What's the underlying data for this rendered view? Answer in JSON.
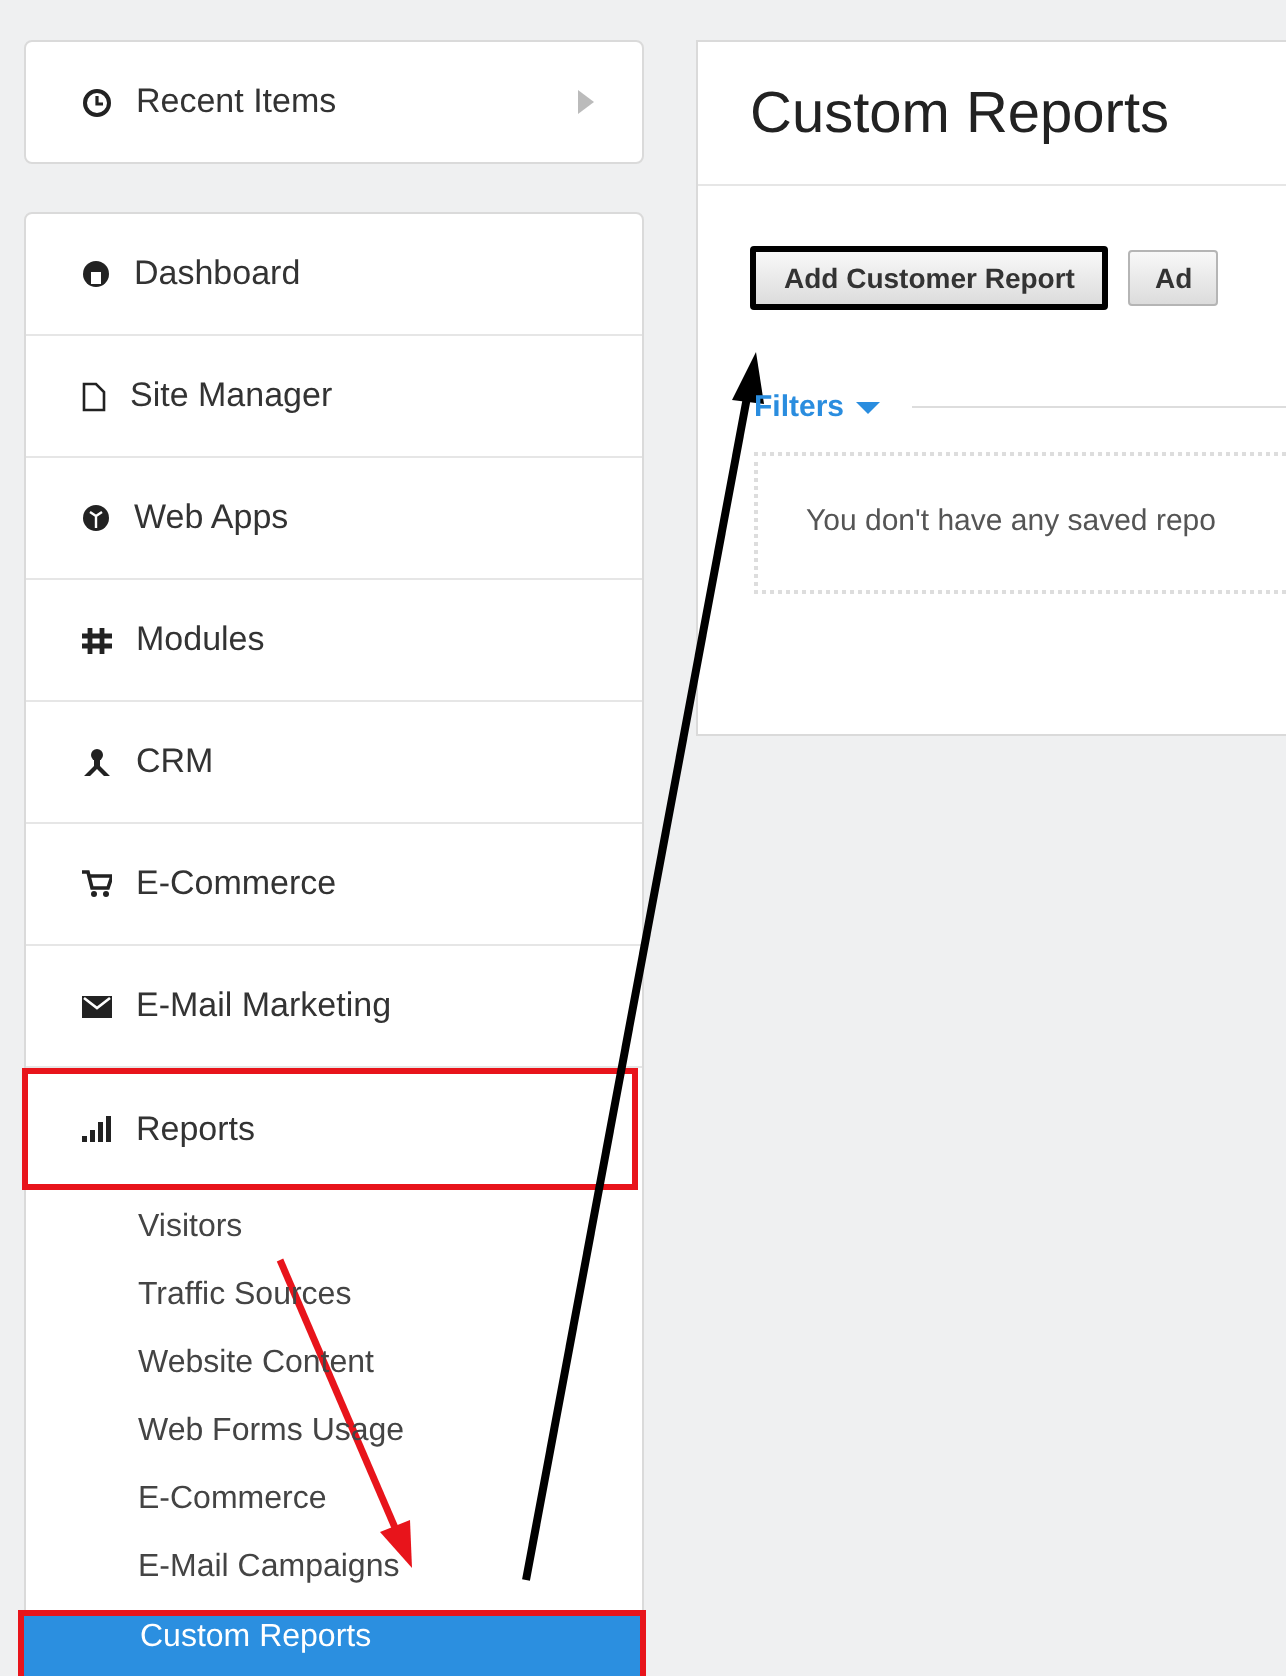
{
  "recent_items": {
    "label": "Recent Items"
  },
  "nav": [
    {
      "label": "Dashboard",
      "kind": "dashboard",
      "highlighted": false
    },
    {
      "label": "Site Manager",
      "kind": "page",
      "highlighted": false
    },
    {
      "label": "Web Apps",
      "kind": "globe",
      "highlighted": false
    },
    {
      "label": "Modules",
      "kind": "modules",
      "highlighted": false
    },
    {
      "label": "CRM",
      "kind": "person",
      "highlighted": false
    },
    {
      "label": "E-Commerce",
      "kind": "cart",
      "highlighted": false
    },
    {
      "label": "E-Mail Marketing",
      "kind": "mail",
      "highlighted": false
    },
    {
      "label": "Reports",
      "kind": "bars",
      "highlighted": true,
      "children": [
        {
          "label": "Visitors",
          "selected": false,
          "highlighted": false
        },
        {
          "label": "Traffic Sources",
          "selected": false,
          "highlighted": false
        },
        {
          "label": "Website Content",
          "selected": false,
          "highlighted": false
        },
        {
          "label": "Web Forms Usage",
          "selected": false,
          "highlighted": false
        },
        {
          "label": "E-Commerce",
          "selected": false,
          "highlighted": false
        },
        {
          "label": "E-Mail Campaigns",
          "selected": false,
          "highlighted": false
        },
        {
          "label": "Custom Reports",
          "selected": true,
          "highlighted": true
        }
      ]
    }
  ],
  "page": {
    "title": "Custom Reports",
    "buttons": [
      {
        "label": "Add Customer Report",
        "highlighted": true
      },
      {
        "label": "Ad",
        "highlighted": false
      }
    ],
    "filters": "Filters",
    "empty_message": "You don't have any saved repo"
  }
}
